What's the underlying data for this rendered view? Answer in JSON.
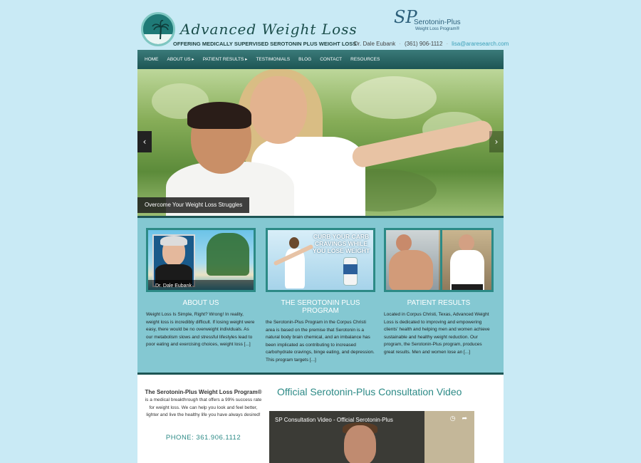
{
  "header": {
    "brand_title": "Advanced Weight Loss",
    "brand_tagline": "OFFERING MEDICALLY SUPERVISED SEROTONIN PLUS WEIGHT LOSS",
    "sp_mark": "SP",
    "sp_name": "Serotonin-Plus",
    "sp_sub": "Weight Loss Program®",
    "doctor": "Dr. Dale Eubank",
    "phone": "(361) 906-1112",
    "email": "lisa@araresearch.com"
  },
  "nav": {
    "items": [
      "HOME",
      "ABOUT US ▸",
      "PATIENT RESULTS ▸",
      "TESTIMONIALS",
      "BLOG",
      "CONTACT",
      "RESOURCES"
    ]
  },
  "hero": {
    "caption": "Overcome Your Weight Loss Struggles",
    "prev_icon": "‹",
    "next_icon": "›"
  },
  "features": {
    "about": {
      "image_caption": "Dr. Dale Eubank",
      "title": "ABOUT US",
      "text": "Weight Loss Is Simple, Right? Wrong! In reality, weight loss is incredibly difficult. If losing weight were easy, there would be no overweight individuals. As our metabolism slows and stressful lifestyles lead to poor eating and exercising choices, weight loss [...]"
    },
    "program": {
      "image_text": "CURB YOUR CARB CRAVINGS WHILE YOU LOSE WEIGHT",
      "title": "THE SEROTONIN PLUS PROGRAM",
      "text": "the Serotonin-Plus Program in the Corpus Christi area is based on the premise that Serotonin is a natural body brain chemical, and an imbalance has been implicated as contributing to increased carbohydrate cravings, binge eating, and depression. This program targets [...]"
    },
    "results": {
      "title": "PATIENT RESULTS",
      "text": "Located in Corpus Christi, Texas, Advanced Weight Loss is dedicated to improving and empowering clients' health and helping men and women achieve sustainable and healthy weight reduction. Our program, the Serotonin-Plus program, produces great results. Men and women lose an [...]"
    }
  },
  "bottom": {
    "promo_title": "The Serotonin-Plus Weight Loss Program®",
    "promo_text": "is a medical breakthrough that offers a 99% success rate for weight loss. We can help you look and feel better, lighter and live the healthy life you have always desired!",
    "phone": "PHONE: 361.906.1112",
    "video_heading": "Official Serotonin-Plus Consultation Video",
    "video_title": "SP Consultation Video - Official Serotonin-Plus"
  },
  "colors": {
    "background": "#c9eaf5",
    "nav": "#1d5554",
    "features_bg": "#84c8d2",
    "accent": "#2c8a86"
  }
}
